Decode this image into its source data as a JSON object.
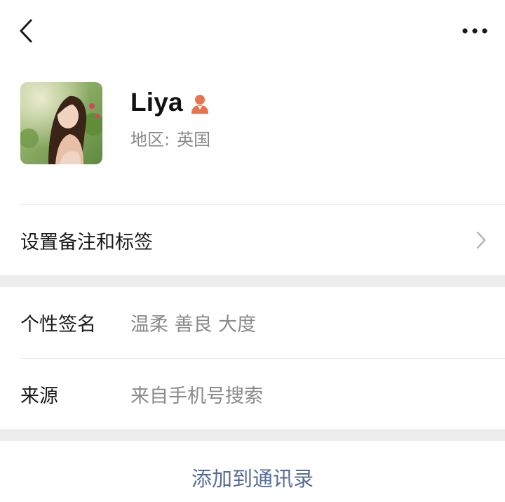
{
  "nav": {
    "back_icon": "chevron-left-icon",
    "more_icon": "more-dots-icon"
  },
  "profile": {
    "name": "Liya",
    "gender_icon": "female-icon",
    "gender_color": "#e8744b",
    "region_label": "地区:",
    "region_value": "英国"
  },
  "settings_row": {
    "label": "设置备注和标签"
  },
  "info": {
    "signature_label": "个性签名",
    "signature_value": "温柔 善良 大度",
    "source_label": "来源",
    "source_value": "来自手机号搜索"
  },
  "action": {
    "add_contact_label": "添加到通讯录",
    "link_color": "#576b95"
  }
}
